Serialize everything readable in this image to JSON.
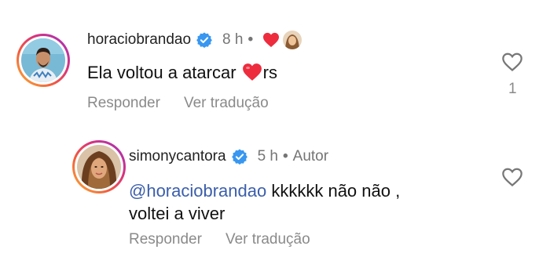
{
  "comments": [
    {
      "username": "horaciobrandao",
      "verified": true,
      "time": "8 h",
      "separator": "•",
      "text_before_emoji": "Ela voltou a atarcar ",
      "emoji": "red-heart",
      "text_after_emoji": "rs",
      "reply_label": "Responder",
      "translate_label": "Ver tradução",
      "like_count": "1",
      "creator_liked": true
    },
    {
      "username": "simonycantora",
      "verified": true,
      "time": "5 h",
      "separator": "•",
      "badge": "Autor",
      "mention": "@horaciobrandao",
      "text_line1": " kkkkkk não não ,",
      "text_line2": "voltei a viver",
      "reply_label": "Responder",
      "translate_label": "Ver tradução"
    }
  ],
  "colors": {
    "verified_blue": "#3897f0",
    "heart_red": "#ed2c3e",
    "mention_blue": "#3b5eab",
    "muted_text": "#8a8a8a"
  }
}
